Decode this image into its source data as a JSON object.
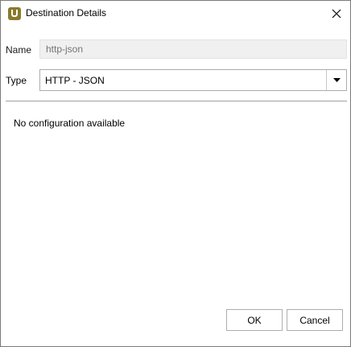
{
  "window": {
    "title": "Destination Details",
    "icon": "app-logo-icon",
    "close_icon": "close-icon"
  },
  "form": {
    "name_label": "Name",
    "name_placeholder": "http-json",
    "name_value": "",
    "type_label": "Type",
    "type_selected": "HTTP - JSON",
    "type_dropdown_icon": "chevron-down-icon"
  },
  "config": {
    "message": "No configuration available"
  },
  "buttons": {
    "ok_label": "OK",
    "cancel_label": "Cancel"
  },
  "colors": {
    "app_icon_bg": "#8b7a2b",
    "disabled_field_bg": "#f0f0f0",
    "placeholder_text": "#b8b8b8"
  }
}
